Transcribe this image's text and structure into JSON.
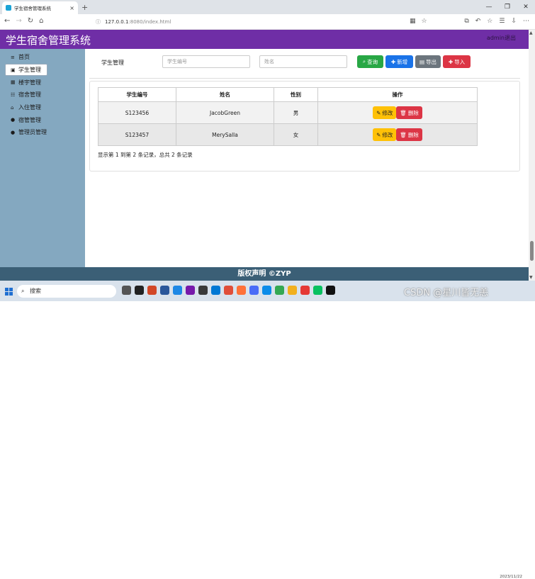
{
  "browser": {
    "tab_title": "学生宿舍管理系统",
    "tab_close": "×",
    "new_tab": "+",
    "url_host": "127.0.0.1",
    "url_path": ":8080/index.html"
  },
  "app": {
    "title": "学生宿舍管理系统",
    "logout": "admin退出"
  },
  "sidebar": {
    "items": [
      {
        "label": "首页",
        "icon": "≡"
      },
      {
        "label": "学生管理",
        "icon": "▣"
      },
      {
        "label": "楼宇管理",
        "icon": "▦"
      },
      {
        "label": "宿舍管理",
        "icon": "☷"
      },
      {
        "label": "入住管理",
        "icon": "⌂"
      },
      {
        "label": "宿管管理",
        "icon": "●"
      },
      {
        "label": "管理员管理",
        "icon": "●"
      }
    ]
  },
  "toolbar": {
    "label": "学生管理",
    "id_placeholder": "学生编号",
    "name_placeholder": "姓名",
    "query": "查询",
    "add": "新增",
    "export": "导出",
    "import": "导入"
  },
  "table": {
    "headers": [
      "学生编号",
      "姓名",
      "性别",
      "操作"
    ],
    "rows": [
      {
        "id": "S123456",
        "name": "JacobGreen",
        "gender": "男"
      },
      {
        "id": "S123457",
        "name": "MerySalla",
        "gender": "女"
      }
    ],
    "edit": "修改",
    "delete": "删除",
    "summary": "显示第 1 到第 2 条记录，总共 2 条记录"
  },
  "footer": "版权声明 ©ZYP",
  "taskbar": {
    "search": "搜索",
    "watermark": "CSDN @星川皆无恙",
    "date": "2023/11/22"
  },
  "colors": {
    "header": "#6f2ea6",
    "sidebar": "#84a8c0",
    "footer": "#3b5f76"
  }
}
